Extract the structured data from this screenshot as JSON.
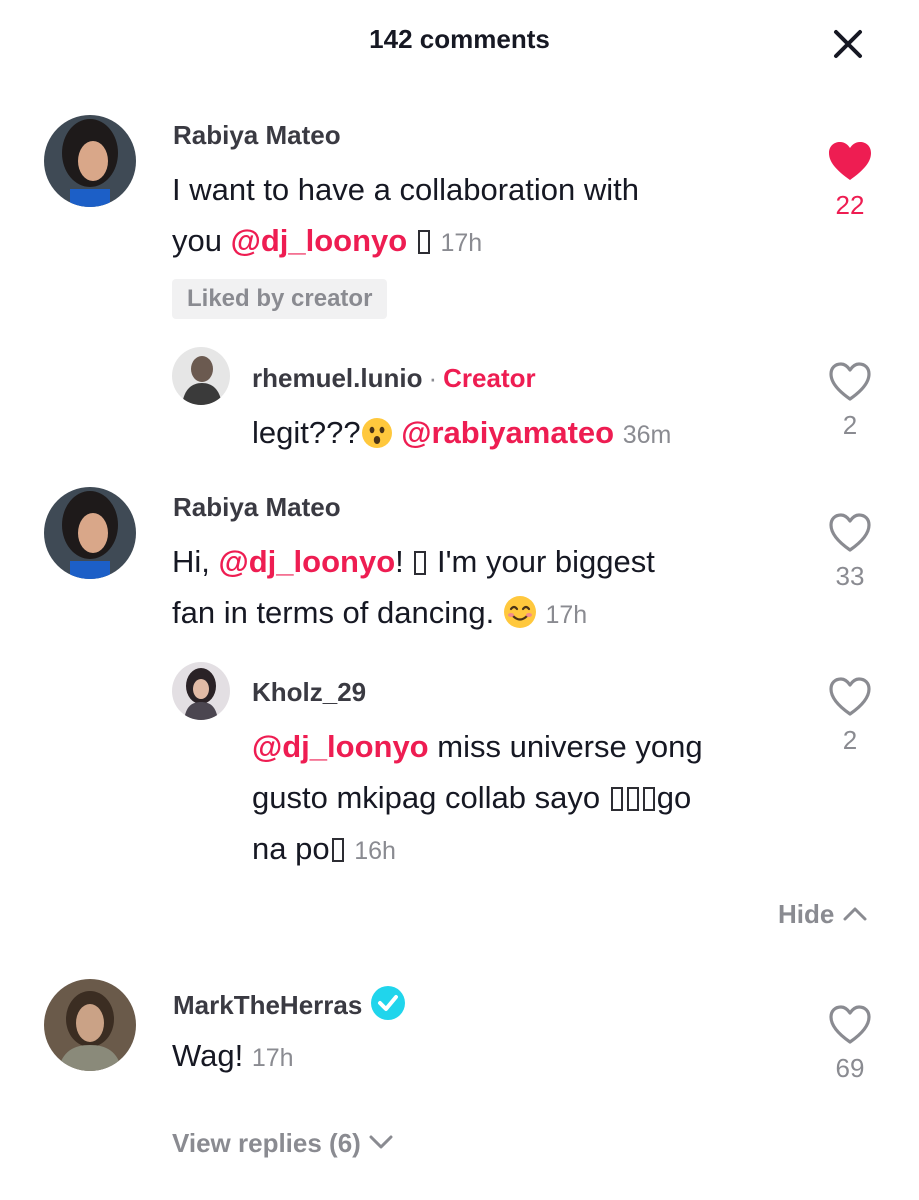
{
  "header": {
    "title": "142 comments"
  },
  "comments": [
    {
      "username": "Rabiya Mateo",
      "text_a": "I want to have a collaboration with",
      "text_b": "you",
      "mention": "@dj_loonyo",
      "time": "17h",
      "badge": "Liked by creator",
      "likes": "22",
      "liked": true
    },
    {
      "username": "rhemuel.lunio",
      "separator": "·",
      "tag": "Creator",
      "text": "legit???",
      "mention": "@rabiyamateo",
      "time": "36m",
      "likes": "2"
    },
    {
      "username": "Rabiya Mateo",
      "text_a": "Hi,",
      "mention": "@dj_loonyo",
      "text_b": "!",
      "text_c": "I'm your biggest",
      "text_d": "fan in terms of dancing.",
      "time": "17h",
      "likes": "33"
    },
    {
      "username": "Kholz_29",
      "mention": "@dj_loonyo",
      "text_a": "miss universe yong",
      "text_b": "gusto mkipag collab sayo",
      "text_c": "go",
      "text_d": "na po",
      "time": "16h",
      "likes": "2"
    },
    {
      "username": "MarkTheHerras",
      "verified": true,
      "text": "Wag!",
      "time": "17h",
      "likes": "69"
    }
  ],
  "actions": {
    "hide_label": "Hide",
    "view_replies_label": "View replies (6)"
  },
  "colors": {
    "accent": "#ee1d52",
    "muted": "#8a8b91",
    "verified": "#20d5ec"
  },
  "icons": [
    "close-icon",
    "heart-filled-icon",
    "heart-outline-icon",
    "verified-icon",
    "chevron-up-icon",
    "chevron-down-icon",
    "astonished-face-emoji",
    "smiling-face-emoji"
  ]
}
